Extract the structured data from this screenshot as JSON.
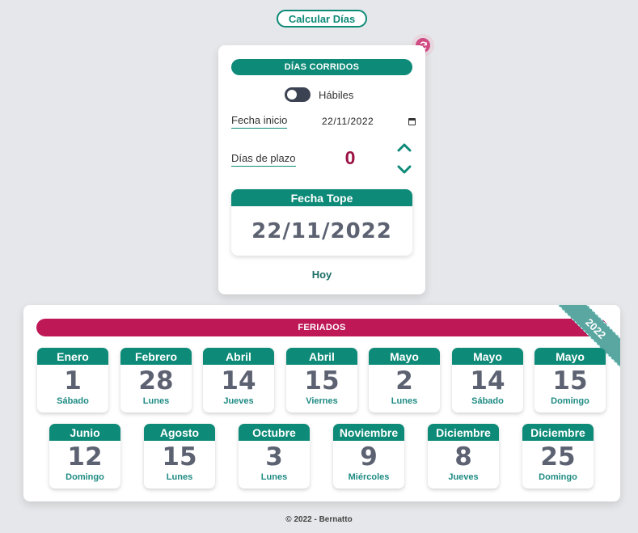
{
  "header": {
    "calc_button": "Calcular Días"
  },
  "calculator": {
    "title": "DÍAS CORRIDOS",
    "toggle_label": "Hábiles",
    "toggle_on": false,
    "start_label": "Fecha inicio",
    "start_value": "22/11/2022",
    "days_label": "Días de plazo",
    "days_value": "0",
    "result_title": "Fecha Tope",
    "result_value": "22/11/2022",
    "today_link": "Hoy"
  },
  "holidays": {
    "title": "FERIADOS",
    "year": "2022",
    "row1": [
      {
        "month": "Enero",
        "day": "1",
        "weekday": "Sábado"
      },
      {
        "month": "Febrero",
        "day": "28",
        "weekday": "Lunes"
      },
      {
        "month": "Abril",
        "day": "14",
        "weekday": "Jueves"
      },
      {
        "month": "Abril",
        "day": "15",
        "weekday": "Viernes"
      },
      {
        "month": "Mayo",
        "day": "2",
        "weekday": "Lunes"
      },
      {
        "month": "Mayo",
        "day": "14",
        "weekday": "Sábado"
      },
      {
        "month": "Mayo",
        "day": "15",
        "weekday": "Domingo"
      }
    ],
    "row2": [
      {
        "month": "Junio",
        "day": "12",
        "weekday": "Domingo"
      },
      {
        "month": "Agosto",
        "day": "15",
        "weekday": "Lunes"
      },
      {
        "month": "Octubre",
        "day": "3",
        "weekday": "Lunes"
      },
      {
        "month": "Noviembre",
        "day": "9",
        "weekday": "Miércoles"
      },
      {
        "month": "Diciembre",
        "day": "8",
        "weekday": "Jueves"
      },
      {
        "month": "Diciembre",
        "day": "25",
        "weekday": "Domingo"
      }
    ]
  },
  "footer": {
    "text": "© 2022 - Bernatto"
  },
  "colors": {
    "teal": "#0e8a78",
    "crimson": "#be1856",
    "counter": "#9c1346",
    "refresh": "#d14c84"
  },
  "icons": {
    "refresh": "refresh-icon",
    "calendar": "calendar-icon",
    "up": "chevron-up-icon",
    "down": "chevron-down-icon"
  }
}
